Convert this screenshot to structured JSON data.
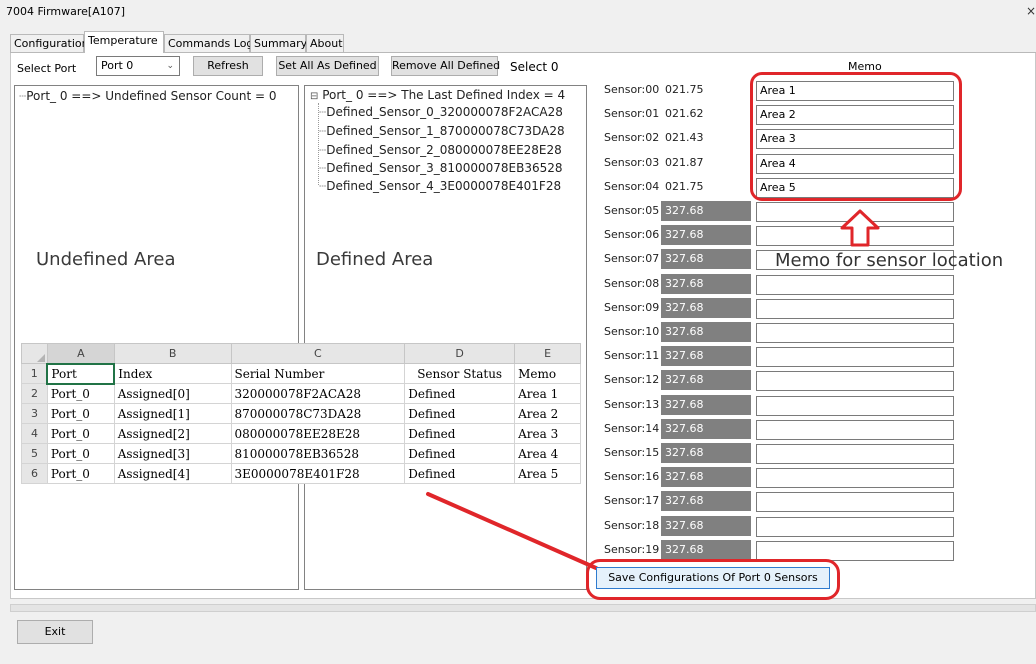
{
  "window": {
    "title": "7004 Firmware[A107]",
    "close_glyph": "×"
  },
  "tabs": [
    {
      "label": "Configuration"
    },
    {
      "label": "Temperature"
    },
    {
      "label": "Commands Log"
    },
    {
      "label": "Summary"
    },
    {
      "label": "About"
    }
  ],
  "toolbar": {
    "select_port_label": "Select Port",
    "port_value": "Port 0",
    "refresh": "Refresh",
    "set_all": "Set All As Defined",
    "remove_all": "Remove All Defined",
    "select_status": "Select 0"
  },
  "undefined_panel": {
    "tree_text": "Port_ 0 ==> Undefined Sensor Count = 0",
    "area_label": "Undefined Area"
  },
  "defined_panel": {
    "tree_root": "Port_ 0 ==> The Last Defined Index = 4",
    "items": [
      "Defined_Sensor_0_320000078F2ACA28",
      "Defined_Sensor_1_870000078C73DA28",
      "Defined_Sensor_2_080000078EE28E28",
      "Defined_Sensor_3_810000078EB36528",
      "Defined_Sensor_4_3E0000078E401F28"
    ],
    "area_label": "Defined Area"
  },
  "spreadsheet": {
    "col_headers": [
      "A",
      "B",
      "C",
      "D",
      "E"
    ],
    "rows": [
      [
        "1",
        "Port",
        "Index",
        "Serial Number",
        "Sensor Status",
        "Memo"
      ],
      [
        "2",
        "Port_0",
        "Assigned[0]",
        "320000078F2ACA28",
        "Defined",
        "Area 1"
      ],
      [
        "3",
        "Port_0",
        "Assigned[1]",
        "870000078C73DA28",
        "Defined",
        "Area 2"
      ],
      [
        "4",
        "Port_0",
        "Assigned[2]",
        "080000078EE28E28",
        "Defined",
        "Area 3"
      ],
      [
        "5",
        "Port_0",
        "Assigned[3]",
        "810000078EB36528",
        "Defined",
        "Area 4"
      ],
      [
        "6",
        "Port_0",
        "Assigned[4]",
        "3E0000078E401F28",
        "Defined",
        "Area 5"
      ]
    ]
  },
  "memo_header": "Memo",
  "sensors": [
    {
      "label": "Sensor:00",
      "value": "021.75",
      "memo": "Area 1",
      "defined": true
    },
    {
      "label": "Sensor:01",
      "value": "021.62",
      "memo": "Area 2",
      "defined": true
    },
    {
      "label": "Sensor:02",
      "value": "021.43",
      "memo": "Area 3",
      "defined": true
    },
    {
      "label": "Sensor:03",
      "value": "021.87",
      "memo": "Area 4",
      "defined": true
    },
    {
      "label": "Sensor:04",
      "value": "021.75",
      "memo": "Area 5",
      "defined": true
    },
    {
      "label": "Sensor:05",
      "value": "327.68",
      "memo": "",
      "defined": false
    },
    {
      "label": "Sensor:06",
      "value": "327.68",
      "memo": "",
      "defined": false
    },
    {
      "label": "Sensor:07",
      "value": "327.68",
      "memo": "",
      "defined": false
    },
    {
      "label": "Sensor:08",
      "value": "327.68",
      "memo": "",
      "defined": false
    },
    {
      "label": "Sensor:09",
      "value": "327.68",
      "memo": "",
      "defined": false
    },
    {
      "label": "Sensor:10",
      "value": "327.68",
      "memo": "",
      "defined": false
    },
    {
      "label": "Sensor:11",
      "value": "327.68",
      "memo": "",
      "defined": false
    },
    {
      "label": "Sensor:12",
      "value": "327.68",
      "memo": "",
      "defined": false
    },
    {
      "label": "Sensor:13",
      "value": "327.68",
      "memo": "",
      "defined": false
    },
    {
      "label": "Sensor:14",
      "value": "327.68",
      "memo": "",
      "defined": false
    },
    {
      "label": "Sensor:15",
      "value": "327.68",
      "memo": "",
      "defined": false
    },
    {
      "label": "Sensor:16",
      "value": "327.68",
      "memo": "",
      "defined": false
    },
    {
      "label": "Sensor:17",
      "value": "327.68",
      "memo": "",
      "defined": false
    },
    {
      "label": "Sensor:18",
      "value": "327.68",
      "memo": "",
      "defined": false
    },
    {
      "label": "Sensor:19",
      "value": "327.68",
      "memo": "",
      "defined": false
    }
  ],
  "annotation": {
    "memo_location": "Memo for sensor location",
    "color": "#e0262a"
  },
  "save_button": "Save Configurations Of Port 0 Sensors",
  "exit_button": "Exit",
  "colors": {
    "undefined_value_bg": "#808080",
    "save_button_border": "#2e7bcf"
  }
}
